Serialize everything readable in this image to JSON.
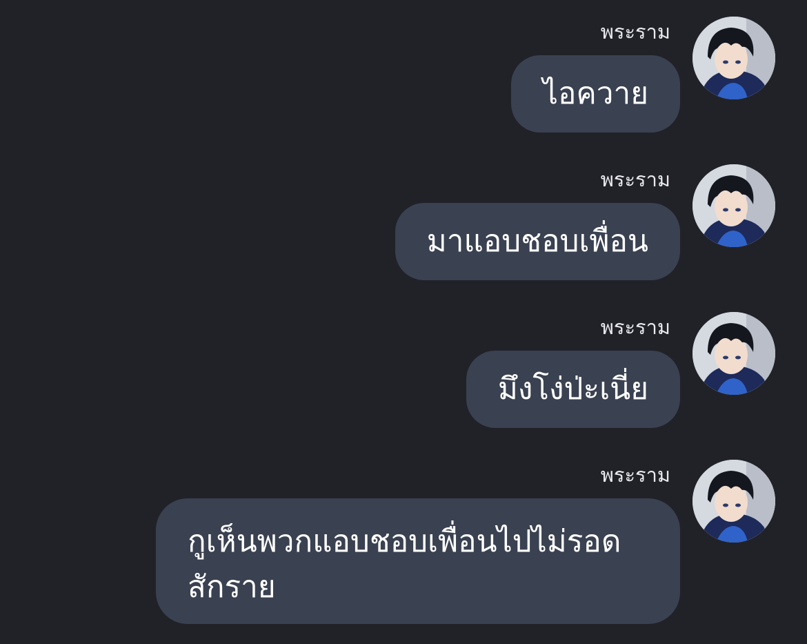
{
  "messages": [
    {
      "sender": "พระราม",
      "text": "ไอควาย"
    },
    {
      "sender": "พระราม",
      "text": "มาแอบชอบเพื่อน"
    },
    {
      "sender": "พระราม",
      "text": "มึงโง่ป่ะเนี่ย"
    },
    {
      "sender": "พระราม",
      "text": "กูเห็นพวกแอบชอบเพื่อนไปไม่รอดสักราย"
    }
  ],
  "colors": {
    "background": "#212228",
    "bubble": "#3a4151",
    "text": "#ffffff"
  },
  "icons": {
    "avatar": "user-avatar-icon"
  }
}
